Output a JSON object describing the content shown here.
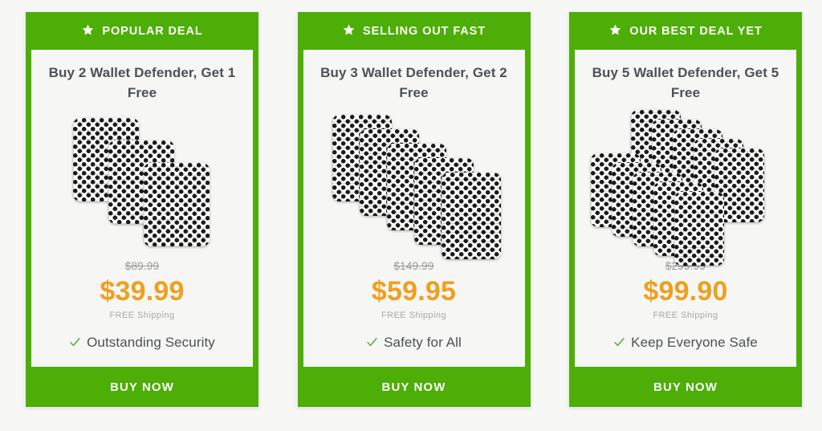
{
  "page": {
    "background_color": "#f7f7f5",
    "accent_green": "#4cae06",
    "price_orange": "#eda020",
    "text_dark": "#4c5156",
    "muted_gray": "#9a9a9a"
  },
  "cards": [
    {
      "badge_icon": "star-icon",
      "badge_label": "POPULAR DEAL",
      "deal_title": "Buy 2 Wallet Defender, Get 1 Free",
      "product_count": 3,
      "product_layout": "diagonal-cascade",
      "old_price": "$89.99",
      "new_price": "$39.99",
      "shipping": "FREE Shipping",
      "feature_icon": "check-icon",
      "feature_label": "Outstanding Security",
      "cta_label": "BUY NOW"
    },
    {
      "badge_icon": "star-icon",
      "badge_label": "SELLING OUT FAST",
      "deal_title": "Buy 3 Wallet Defender, Get 2 Free",
      "product_count": 5,
      "product_layout": "diagonal-cascade",
      "old_price": "$149.99",
      "new_price": "$59.95",
      "shipping": "FREE Shipping",
      "feature_icon": "check-icon",
      "feature_label": "Safety for All",
      "cta_label": "BUY NOW"
    },
    {
      "badge_icon": "star-icon",
      "badge_label": "OUR BEST DEAL YET",
      "deal_title": "Buy 5 Wallet Defender, Get 5 Free",
      "product_count": 10,
      "product_layout": "two-row-cascade",
      "old_price": "$299.99",
      "new_price": "$99.90",
      "shipping": "FREE Shipping",
      "feature_icon": "check-icon",
      "feature_label": "Keep Everyone Safe",
      "cta_label": "BUY NOW"
    }
  ]
}
